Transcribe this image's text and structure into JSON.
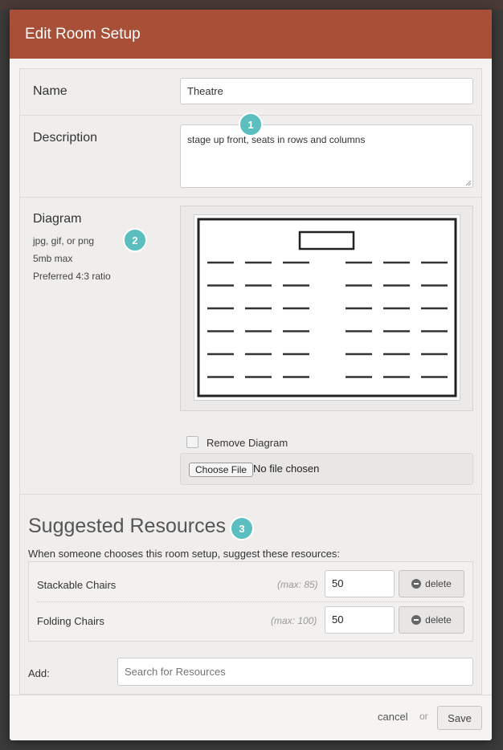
{
  "modal": {
    "title": "Edit Room Setup"
  },
  "name": {
    "label": "Name",
    "value": "Theatre"
  },
  "description": {
    "label": "Description",
    "value": "stage up front, seats in rows and columns"
  },
  "diagram": {
    "label": "Diagram",
    "hints": [
      "jpg, gif, or png",
      "5mb max",
      "Preferred 4:3 ratio"
    ],
    "remove_label": "Remove Diagram",
    "remove_checked": false,
    "file_button": "Choose File",
    "file_status": "No file chosen"
  },
  "badges": [
    "1",
    "2",
    "3"
  ],
  "resources": {
    "title": "Suggested Resources",
    "subtitle": "When someone chooses this room setup, suggest these resources:",
    "items": [
      {
        "name": "Stackable Chairs",
        "max": "(max: 85)",
        "qty": "50",
        "delete_label": "delete"
      },
      {
        "name": "Folding Chairs",
        "max": "(max: 100)",
        "qty": "50",
        "delete_label": "delete"
      }
    ],
    "add_label": "Add:",
    "search_placeholder": "Search for Resources"
  },
  "footer": {
    "cancel": "cancel",
    "or": "or",
    "save": "Save"
  },
  "colors": {
    "header": "#a84f37",
    "badge": "#5bbfbf"
  },
  "icons": [
    "minus-circle-icon",
    "resize-grip-icon"
  ]
}
